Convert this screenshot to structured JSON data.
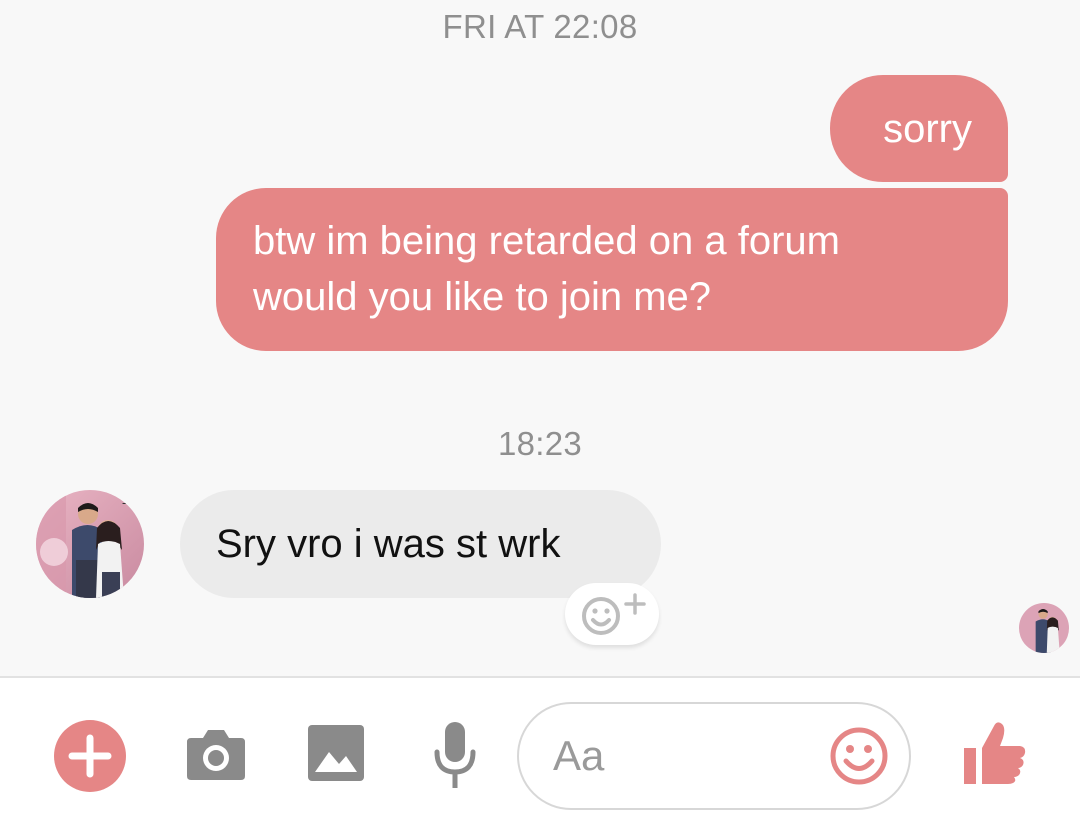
{
  "conversation": {
    "timestamps": {
      "first": "FRI AT 22:08",
      "second": "18:23"
    },
    "outgoing": {
      "sorry": "sorry",
      "long_line_1": "btw im being retarded on a forum",
      "long_line_2": "would you like to join me?"
    },
    "incoming": {
      "message": "Sry vro i was st wrk"
    }
  },
  "composer": {
    "placeholder": "Aa"
  },
  "icons": {
    "add": "plus-circle-icon",
    "camera": "camera-icon",
    "gallery": "image-icon",
    "microphone": "microphone-icon",
    "emoji": "smiley-icon",
    "reaction": "add-reaction-icon",
    "like": "thumbs-up-icon"
  },
  "colors": {
    "accent": "#e58686",
    "incoming_bubble": "#ebebeb",
    "timestamp": "#8f8f8f",
    "icon_gray": "#8a8a8a"
  }
}
